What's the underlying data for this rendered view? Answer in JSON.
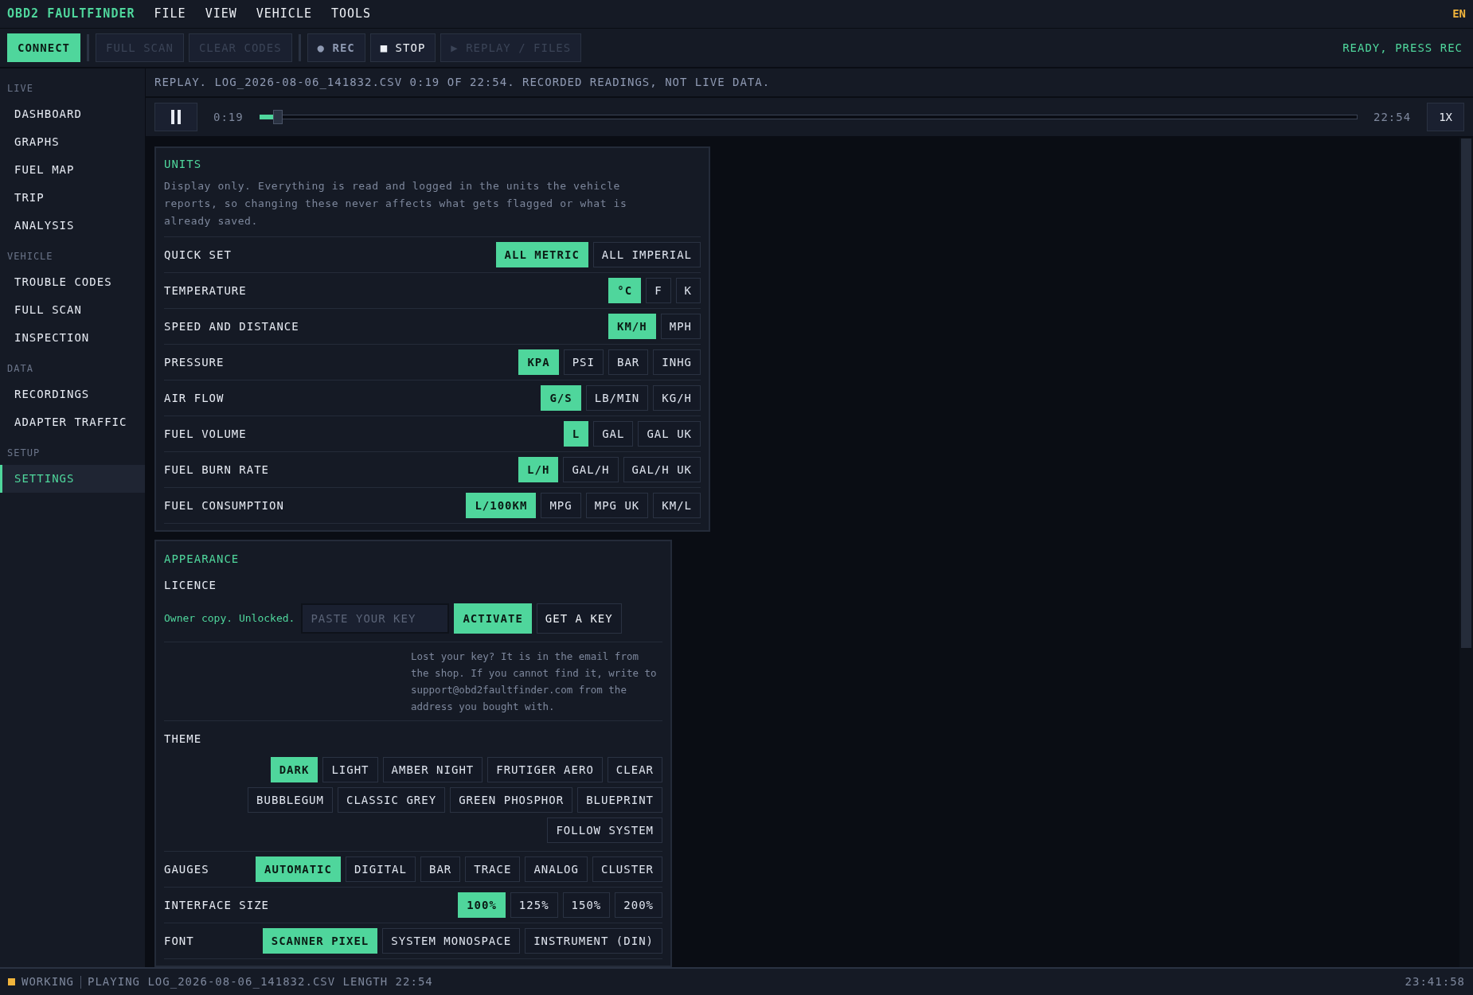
{
  "app": {
    "title": "OBD2 FAULTFINDER",
    "menu": [
      "FILE",
      "VIEW",
      "VEHICLE",
      "TOOLS"
    ],
    "language": "EN"
  },
  "toolbar": {
    "buttons": [
      {
        "kind": "primary",
        "label": "CONNECT",
        "disabled": false
      },
      {
        "kind": "separator"
      },
      {
        "kind": "normal",
        "label": "FULL SCAN",
        "disabled": true
      },
      {
        "kind": "normal",
        "label": "CLEAR CODES",
        "disabled": true
      },
      {
        "kind": "separator"
      },
      {
        "kind": "dim",
        "icon": "●",
        "label": "REC",
        "disabled": false
      },
      {
        "kind": "normal",
        "icon": "■",
        "label": "STOP",
        "disabled": false
      },
      {
        "kind": "normal",
        "icon": "▶",
        "label": "REPLAY / FILES",
        "disabled": true
      }
    ],
    "status": "READY, PRESS REC"
  },
  "sidebar": {
    "sections": [
      {
        "heading": "LIVE",
        "items": [
          {
            "label": "DASHBOARD",
            "selected": false
          },
          {
            "label": "GRAPHS",
            "selected": false
          },
          {
            "label": "FUEL MAP",
            "selected": false
          },
          {
            "label": "TRIP",
            "selected": false
          },
          {
            "label": "ANALYSIS",
            "selected": false
          }
        ]
      },
      {
        "heading": "VEHICLE",
        "items": [
          {
            "label": "TROUBLE CODES",
            "selected": false
          },
          {
            "label": "FULL SCAN",
            "selected": false
          },
          {
            "label": "INSPECTION",
            "selected": false
          }
        ]
      },
      {
        "heading": "DATA",
        "items": [
          {
            "label": "RECORDINGS",
            "selected": false
          },
          {
            "label": "ADAPTER TRAFFIC",
            "selected": false
          }
        ]
      },
      {
        "heading": "SETUP",
        "items": [
          {
            "label": "SETTINGS",
            "selected": true
          }
        ]
      }
    ]
  },
  "replay": {
    "banner": "REPLAY. LOG_2026-08-06_141832.CSV 0:19 OF 22:54. RECORDED READINGS, NOT LIVE DATA.",
    "playing": true,
    "elapsed": "0:19",
    "level": 0.014,
    "total": "22:54",
    "speed": "1X"
  },
  "units": {
    "title": "UNITS",
    "description": "Display only. Everything is read and logged in the units the vehicle reports, so changing these never affects what gets flagged or what is already saved.",
    "rows": [
      {
        "label": "QUICK SET",
        "options": [
          {
            "label": "ALL METRIC",
            "selected": true
          },
          {
            "label": "ALL IMPERIAL",
            "selected": false
          }
        ]
      },
      {
        "label": "TEMPERATURE",
        "options": [
          {
            "label": "°C",
            "selected": true
          },
          {
            "label": "F",
            "selected": false
          },
          {
            "label": "K",
            "selected": false
          }
        ]
      },
      {
        "label": "SPEED AND DISTANCE",
        "options": [
          {
            "label": "KM/H",
            "selected": true
          },
          {
            "label": "MPH",
            "selected": false
          }
        ]
      },
      {
        "label": "PRESSURE",
        "options": [
          {
            "label": "KPA",
            "selected": true
          },
          {
            "label": "PSI",
            "selected": false
          },
          {
            "label": "BAR",
            "selected": false
          },
          {
            "label": "INHG",
            "selected": false
          }
        ]
      },
      {
        "label": "AIR FLOW",
        "options": [
          {
            "label": "G/S",
            "selected": true
          },
          {
            "label": "LB/MIN",
            "selected": false
          },
          {
            "label": "KG/H",
            "selected": false
          }
        ]
      },
      {
        "label": "FUEL VOLUME",
        "options": [
          {
            "label": "L",
            "selected": true
          },
          {
            "label": "GAL",
            "selected": false
          },
          {
            "label": "GAL UK",
            "selected": false
          }
        ]
      },
      {
        "label": "FUEL BURN RATE",
        "options": [
          {
            "label": "L/H",
            "selected": true
          },
          {
            "label": "GAL/H",
            "selected": false
          },
          {
            "label": "GAL/H UK",
            "selected": false
          }
        ]
      },
      {
        "label": "FUEL CONSUMPTION",
        "options": [
          {
            "label": "L/100KM",
            "selected": true
          },
          {
            "label": "MPG",
            "selected": false
          },
          {
            "label": "MPG UK",
            "selected": false
          },
          {
            "label": "KM/L",
            "selected": false
          }
        ]
      }
    ]
  },
  "appearance": {
    "title": "APPEARANCE",
    "licence": {
      "heading": "LICENCE",
      "status": "Owner copy. Unlocked.",
      "key_field": {
        "placeholder": "PASTE YOUR KEY"
      },
      "buttons": [
        {
          "label": "ACTIVATE",
          "kind": "primary"
        },
        {
          "label": "GET A KEY",
          "kind": "normal"
        }
      ],
      "help": "Lost your key? It is in the email from the shop. If you cannot find it, write to support@obd2faultfinder.com from the address you bought with."
    },
    "rows": [
      {
        "kind": "wrap",
        "label": "THEME",
        "options": [
          {
            "label": "DARK",
            "selected": true
          },
          {
            "label": "LIGHT",
            "selected": false
          },
          {
            "label": "AMBER NIGHT",
            "selected": false
          },
          {
            "label": "FRUTIGER AERO",
            "selected": false
          },
          {
            "label": "CLEAR",
            "selected": false
          },
          {
            "label": "BUBBLEGUM",
            "selected": false
          },
          {
            "label": "CLASSIC GREY",
            "selected": false
          },
          {
            "label": "GREEN PHOSPHOR",
            "selected": false
          },
          {
            "label": "BLUEPRINT",
            "selected": false
          },
          {
            "label": "FOLLOW SYSTEM",
            "selected": false
          }
        ]
      },
      {
        "kind": "inline",
        "label": "GAUGES",
        "options": [
          {
            "label": "AUTOMATIC",
            "selected": true
          },
          {
            "label": "DIGITAL",
            "selected": false
          },
          {
            "label": "BAR",
            "selected": false
          },
          {
            "label": "TRACE",
            "selected": false
          },
          {
            "label": "ANALOG",
            "selected": false
          },
          {
            "label": "CLUSTER",
            "selected": false
          }
        ]
      },
      {
        "kind": "inline",
        "label": "INTERFACE SIZE",
        "options": [
          {
            "label": "100%",
            "selected": true
          },
          {
            "label": "125%",
            "selected": false
          },
          {
            "label": "150%",
            "selected": false
          },
          {
            "label": "200%",
            "selected": false
          }
        ]
      },
      {
        "kind": "inline",
        "label": "FONT",
        "options": [
          {
            "label": "SCANNER PIXEL",
            "selected": true
          },
          {
            "label": "SYSTEM MONOSPACE",
            "selected": false
          },
          {
            "label": "INSTRUMENT (DIN)",
            "selected": false
          }
        ]
      }
    ]
  },
  "status_bar": {
    "state": "WORKING",
    "busy": true,
    "message": "PLAYING LOG_2026-08-06_141832.CSV LENGTH 22:54",
    "clock": "23:41:58"
  }
}
